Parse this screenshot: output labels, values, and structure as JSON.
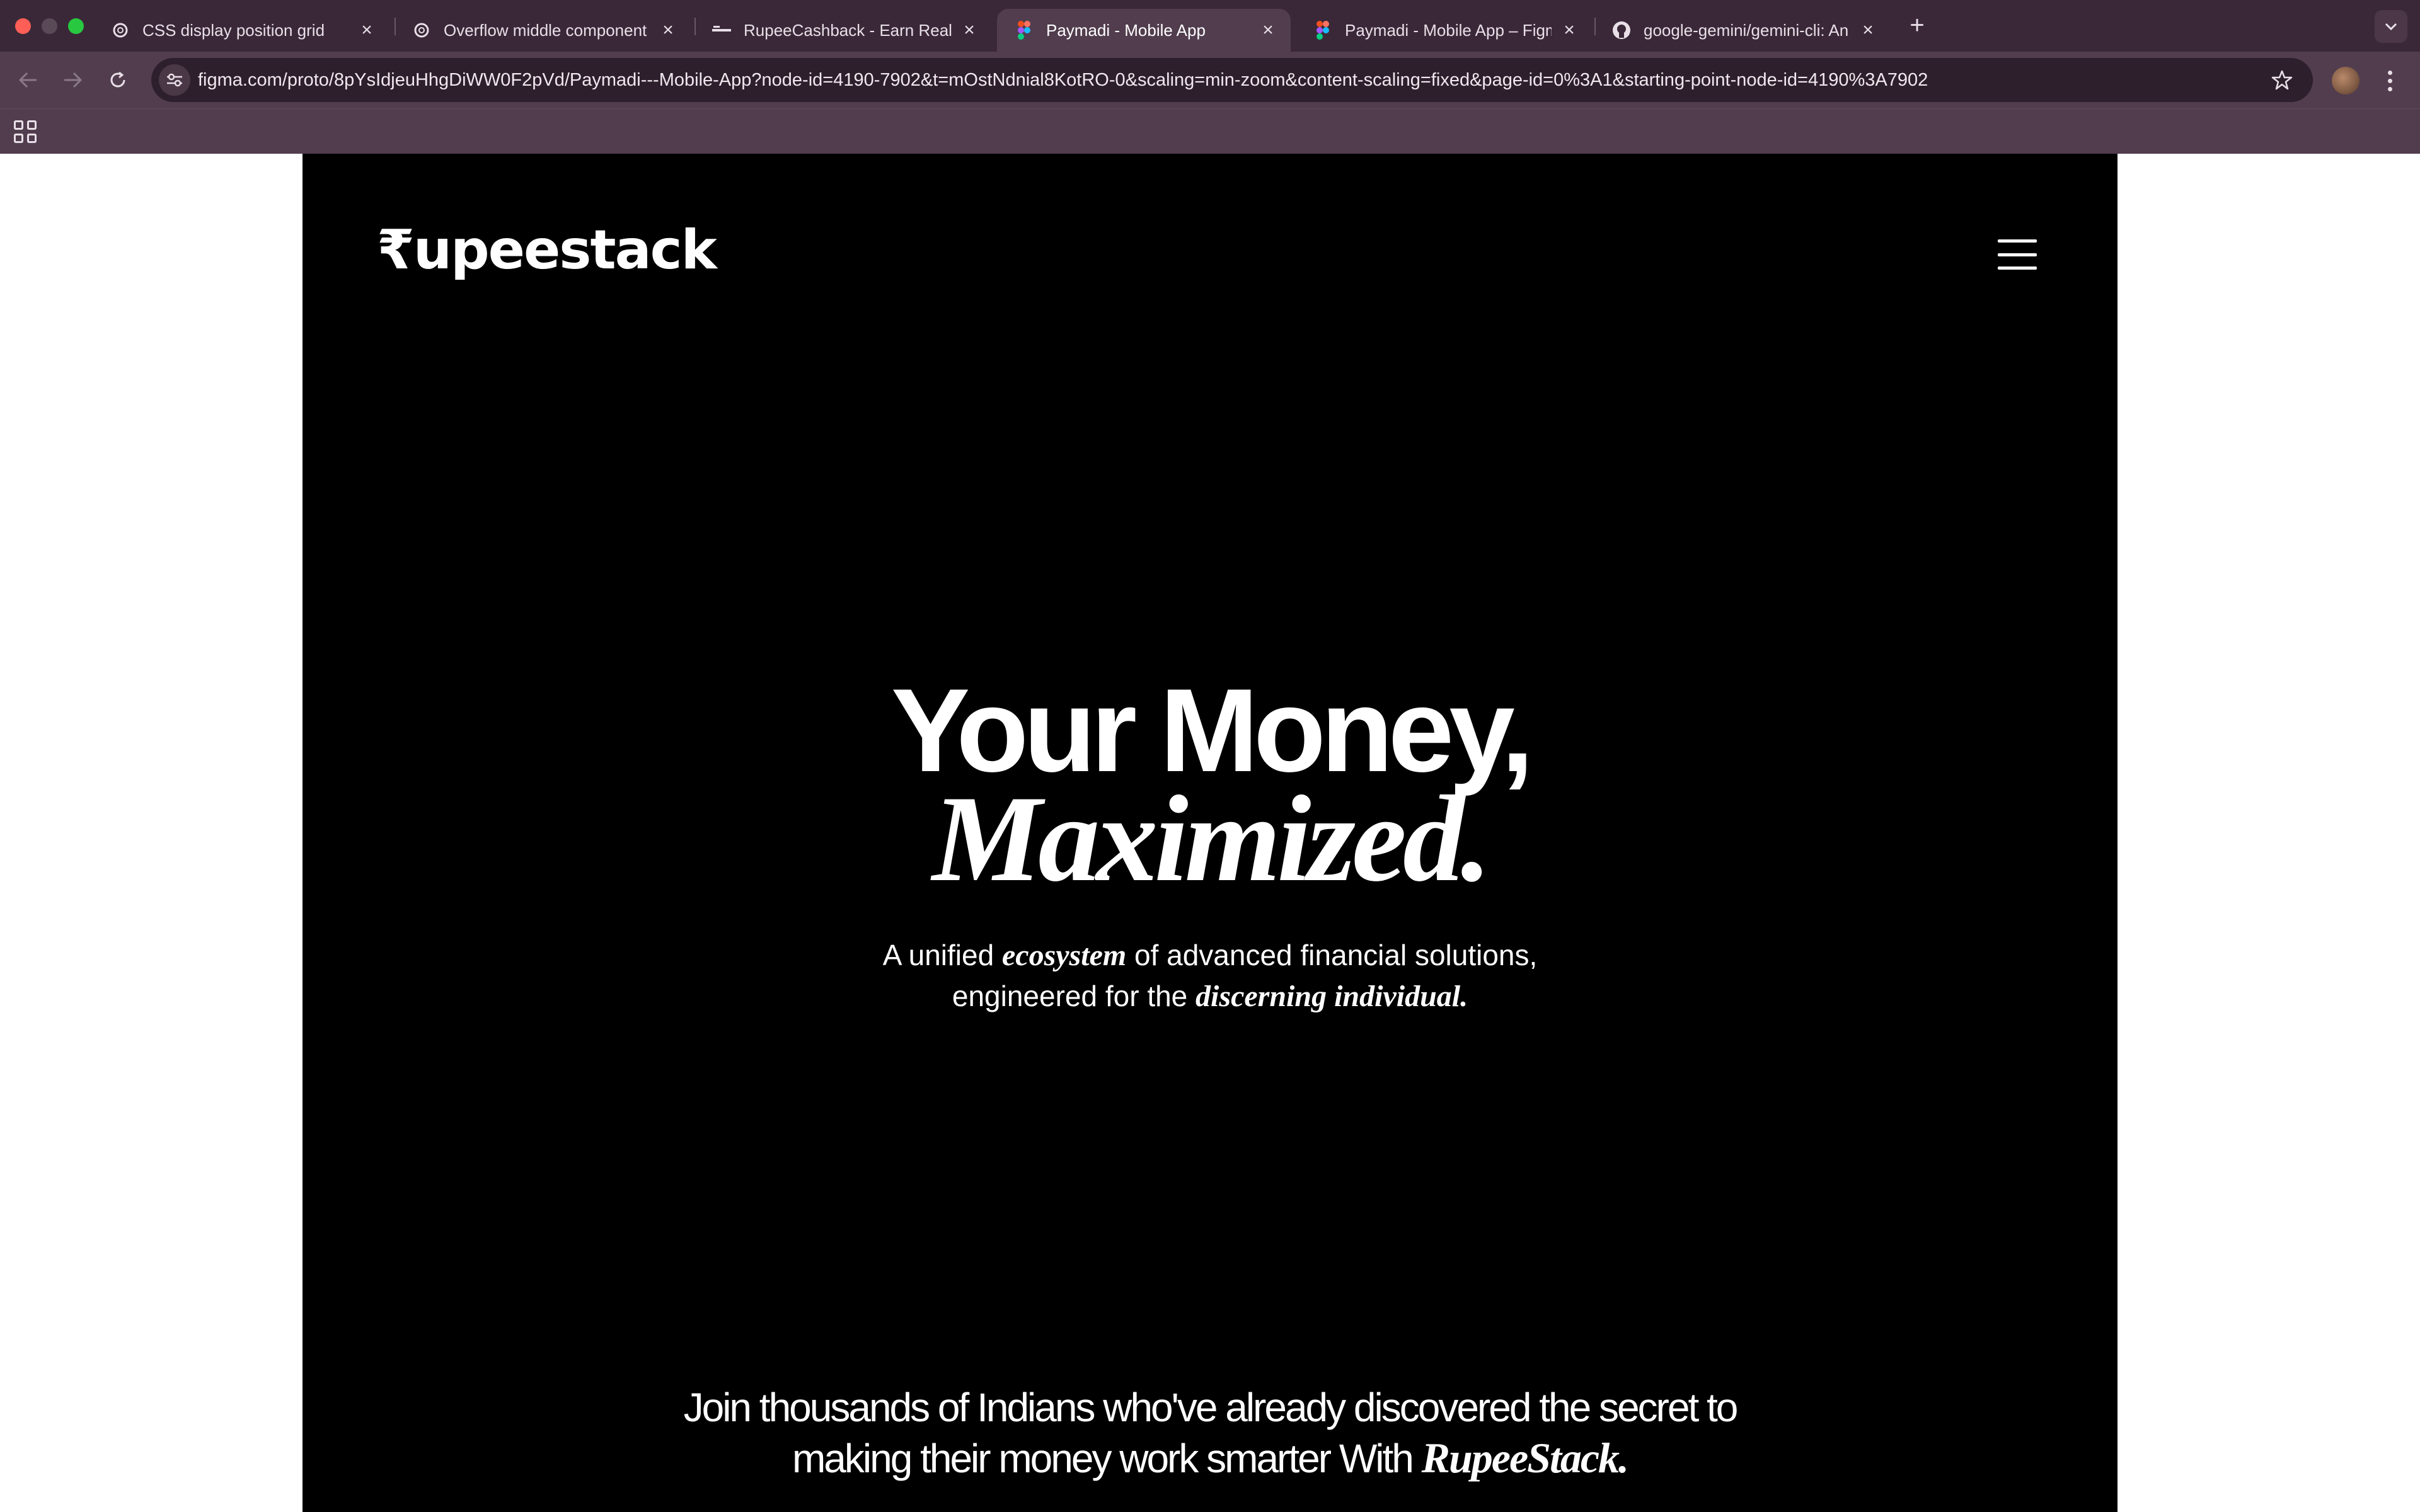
{
  "browser": {
    "tabs": [
      {
        "title": "CSS display position grid",
        "favicon": "openai-icon",
        "active": false
      },
      {
        "title": "Overflow middle component i",
        "favicon": "openai-icon",
        "active": false
      },
      {
        "title": "RupeeCashback - Earn Real M",
        "favicon": "rupeecashback-icon",
        "active": false
      },
      {
        "title": "Paymadi - Mobile App",
        "favicon": "figma-icon",
        "active": true
      },
      {
        "title": "Paymadi - Mobile App – Figm",
        "favicon": "figma-icon",
        "active": false
      },
      {
        "title": "google-gemini/gemini-cli: An",
        "favicon": "github-icon",
        "active": false
      }
    ],
    "url": "figma.com/proto/8pYsIdjeuHhgDiWW0F2pVd/Paymadi---Mobile-App?node-id=4190-7902&t=mOstNdnial8KotRO-0&scaling=min-zoom&content-scaling=fixed&page-id=0%3A1&starting-point-node-id=4190%3A7902",
    "new_tab_label": "+",
    "colors": {
      "tabbar": "#3a2838",
      "toolbar": "#513d4e",
      "omnibox": "#2e1f2c"
    }
  },
  "page": {
    "logo": "₹upeestack",
    "hero": {
      "line1": "Your Money,",
      "line2": "Maximized."
    },
    "subtitle": {
      "part1": "A unified ",
      "emphasis1": "ecosystem",
      "part2": " of advanced financial solutions,",
      "part3": "engineered for the ",
      "emphasis2": "discerning individual."
    },
    "join": {
      "line1": "Join thousands of Indians who've already discovered the secret to",
      "line2": "making their money work smarter With ",
      "brand": "RupeeStack."
    },
    "colors": {
      "background": "#000000",
      "text": "#ffffff"
    }
  }
}
